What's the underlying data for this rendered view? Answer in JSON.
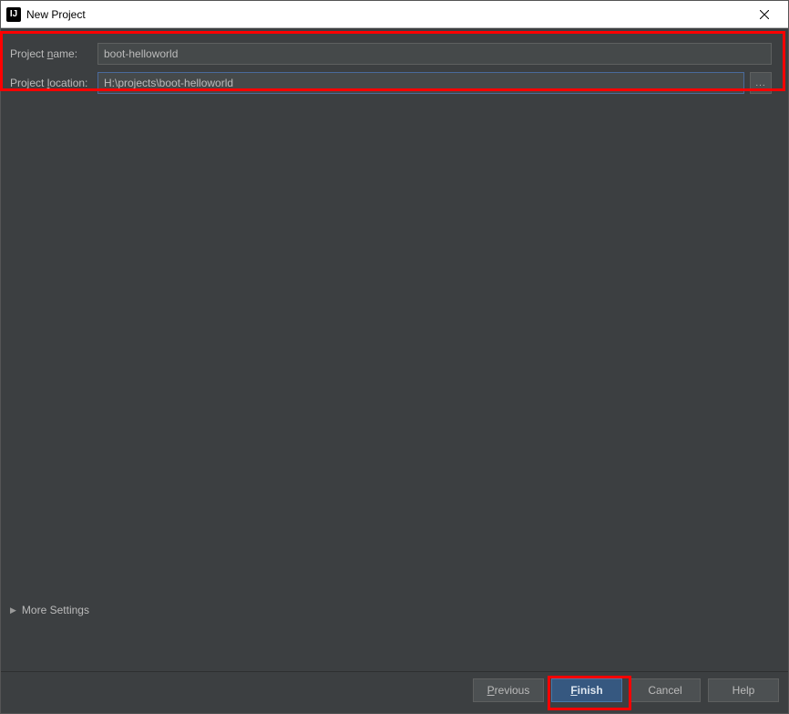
{
  "window": {
    "title": "New Project",
    "app_icon_text": "IJ"
  },
  "form": {
    "name_label_pre": "Project ",
    "name_label_u": "n",
    "name_label_post": "ame:",
    "name_value": "boot-helloworld",
    "location_label_pre": "Project ",
    "location_label_u": "l",
    "location_label_post": "ocation:",
    "location_value": "H:\\projects\\boot-helloworld",
    "browse_label": "..."
  },
  "more_settings": {
    "label": "More Settings"
  },
  "buttons": {
    "previous_u": "P",
    "previous_post": "revious",
    "finish_u": "F",
    "finish_post": "inish",
    "cancel": "Cancel",
    "help": "Help"
  }
}
